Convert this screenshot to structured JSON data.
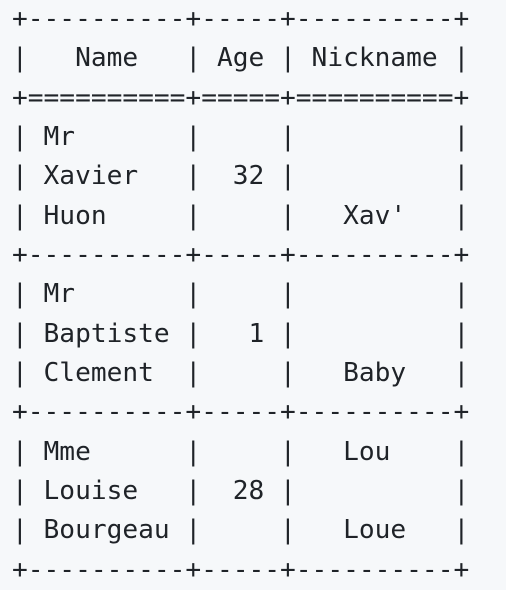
{
  "code_block": {
    "lines": [
      "+----------+-----+----------+",
      "|   Name   | Age | Nickname |",
      "+==========+=====+==========+",
      "| Mr       |     |          |",
      "| Xavier   |  32 |          |",
      "| Huon     |     |   Xav'   |",
      "+----------+-----+----------+",
      "| Mr       |     |          |",
      "| Baptiste |   1 |          |",
      "| Clement  |     |   Baby   |",
      "+----------+-----+----------+",
      "| Mme      |     |   Lou    |",
      "| Louise   |  28 |          |",
      "| Bourgeau |     |   Loue   |",
      "+----------+-----+----------+"
    ]
  }
}
